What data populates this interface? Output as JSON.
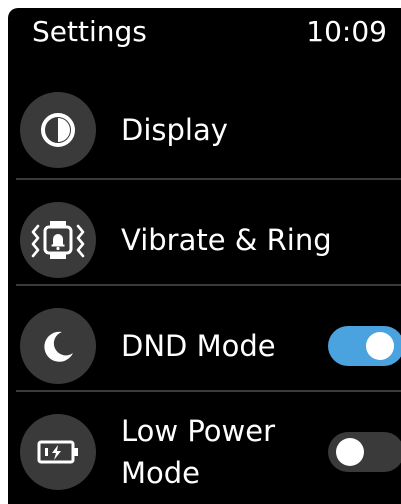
{
  "status_bar": {
    "title": "Settings",
    "time": "10:09"
  },
  "menu": {
    "items": [
      {
        "label": "Display",
        "icon": "display-contrast-icon"
      },
      {
        "label": "Vibrate & Ring",
        "icon": "vibrate-ring-watch-icon"
      },
      {
        "label": "DND Mode",
        "icon": "moon-icon",
        "toggle": "on"
      },
      {
        "label": "Low Power Mode",
        "icon": "battery-charging-icon",
        "toggle": "off"
      }
    ]
  },
  "colors": {
    "background": "#000000",
    "icon_circle": "#3a3a3a",
    "toggle_on": "#4aa3df",
    "toggle_off": "#3a3a3a",
    "text": "#ffffff"
  }
}
